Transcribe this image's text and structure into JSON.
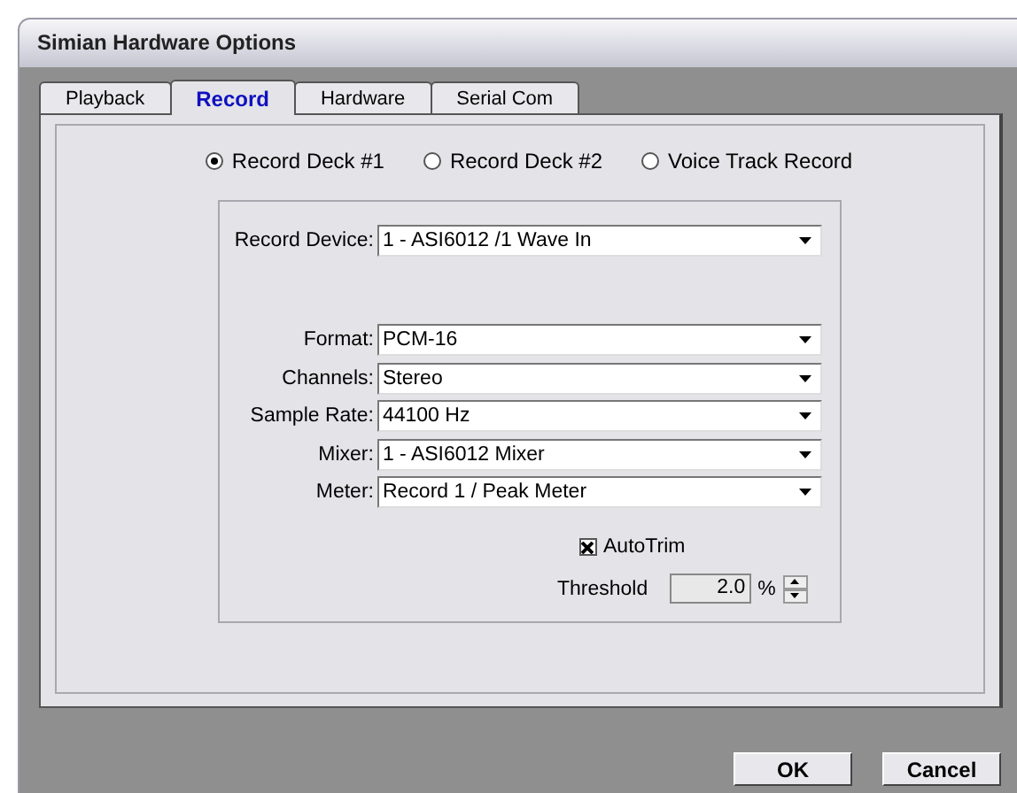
{
  "window": {
    "title": "Simian Hardware Options"
  },
  "tabs": [
    {
      "label": "Playback",
      "selected": false
    },
    {
      "label": "Record",
      "selected": true
    },
    {
      "label": "Hardware",
      "selected": false
    },
    {
      "label": "Serial Com",
      "selected": false
    }
  ],
  "decks": [
    {
      "label": "Record Deck #1",
      "selected": true
    },
    {
      "label": "Record Deck #2",
      "selected": false
    },
    {
      "label": "Voice Track Record",
      "selected": false
    }
  ],
  "record_device": {
    "label": "Record Device:",
    "value": "1 - ASI6012 /1 Wave In"
  },
  "settings": [
    {
      "label": "Format:",
      "value": "PCM-16"
    },
    {
      "label": "Channels:",
      "value": "Stereo"
    },
    {
      "label": "Sample Rate:",
      "value": "44100 Hz"
    },
    {
      "label": "Mixer:",
      "value": "1 - ASI6012 Mixer"
    },
    {
      "label": "Meter:",
      "value": "Record 1 / Peak Meter"
    }
  ],
  "autotrim": {
    "label": "AutoTrim",
    "checked": true
  },
  "threshold": {
    "label": "Threshold",
    "value": "2.0",
    "unit": "%",
    "disabled": true
  },
  "buttons": [
    "OK",
    "Cancel"
  ]
}
